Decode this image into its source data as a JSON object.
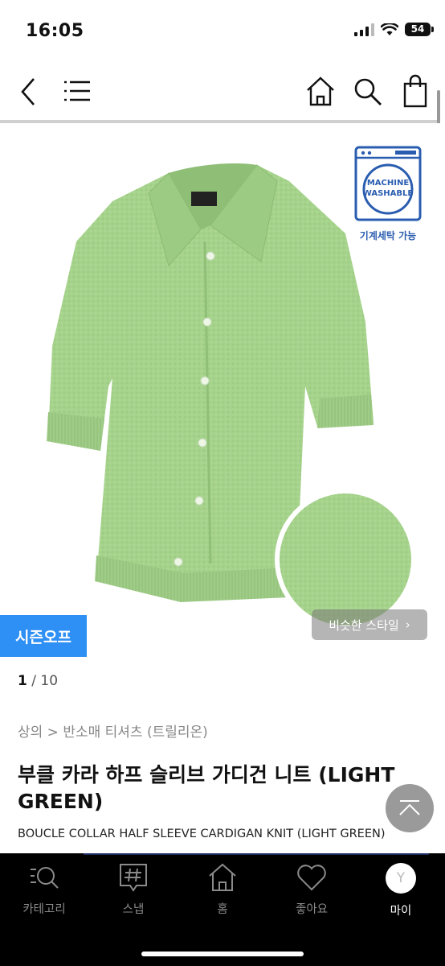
{
  "status": {
    "time": "16:05",
    "battery": "54"
  },
  "header": {
    "icons": [
      "back-icon",
      "menu-icon",
      "home-icon",
      "search-icon",
      "shopping-bag-icon"
    ]
  },
  "badge": {
    "wash_line1": "MACHINE",
    "wash_line2": "WASHABLE",
    "wash_label": "기계세탁 가능"
  },
  "image": {
    "similar_style": "비슷한 스타일",
    "season_badge": "시즌오프",
    "current": "1",
    "total": "/ 10"
  },
  "product": {
    "breadcrumb": "상의 > 반소매 티셔츠 (트릴리온)",
    "title": "부클 카라 하프 슬리브 가디건 니트 (LIGHT GREEN)",
    "subtitle": "BOUCLE COLLAR HALF SLEEVE CARDIGAN KNIT (LIGHT GREEN)"
  },
  "tabs": [
    {
      "label": "카테고리",
      "icon": "category-search-icon"
    },
    {
      "label": "스냅",
      "icon": "hashtag-icon"
    },
    {
      "label": "홈",
      "icon": "home-icon"
    },
    {
      "label": "좋아요",
      "icon": "heart-icon"
    },
    {
      "label": "마이",
      "icon": "avatar",
      "initial": "Y"
    }
  ],
  "colors": {
    "accent": "#2e8ff5",
    "knit": "#a6d38c",
    "tab_bg": "#000000"
  }
}
